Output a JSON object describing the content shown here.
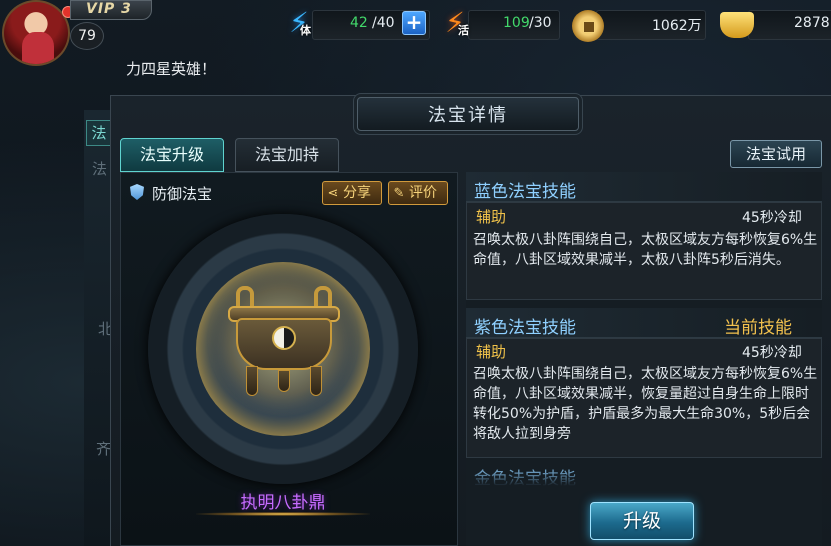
{
  "hud": {
    "vip": "VIP 3",
    "level": "79",
    "stamina": {
      "icon": "stamina-icon",
      "sub": "体",
      "current": "42",
      "max": "/40"
    },
    "vigor": {
      "icon": "vigor-icon",
      "sub": "活",
      "current": "109",
      "max": "/30"
    },
    "coins": {
      "icon": "coin-icon",
      "value": "1062万"
    },
    "ingots": {
      "icon": "ingot-icon",
      "value": "2878"
    },
    "plus_label": "+"
  },
  "ticker": "力四星英雄！",
  "panel": {
    "title": "法宝详情",
    "tabs": [
      {
        "label": "法宝升级",
        "active": true
      },
      {
        "label": "法宝加持",
        "active": false
      }
    ],
    "trial_button": "法宝试用",
    "artifact": {
      "type_label": "防御法宝",
      "share_label": "分享",
      "review_label": "评价",
      "name": "执明八卦鼎",
      "name_color": "#c76cff"
    },
    "skills": [
      {
        "title": "蓝色法宝技能",
        "current": "",
        "type": "辅助",
        "cooldown": "45秒冷却",
        "desc": "召唤太极八卦阵围绕自己，太极区域友方每秒恢复6%生命值，八卦区域效果减半，太极八卦阵5秒后消失。"
      },
      {
        "title": "紫色法宝技能",
        "current": "当前技能",
        "type": "辅助",
        "cooldown": "45秒冷却",
        "desc": "召唤太极八卦阵围绕自己，太极区域友方每秒恢复6%生命值，八卦区域效果减半，恢复量超过自身生命上限时转化50%为护盾，护盾最多为最大生命30%，5秒后会将敌人拉到身旁"
      }
    ],
    "next_skill_peek": "金色法宝技能",
    "upgrade_button": "升级"
  },
  "colors": {
    "accent_teal": "#5fd3cf",
    "skill_title": "#8fd0ff",
    "gold": "#f0c24a",
    "stamina_green": "#43d96b"
  }
}
